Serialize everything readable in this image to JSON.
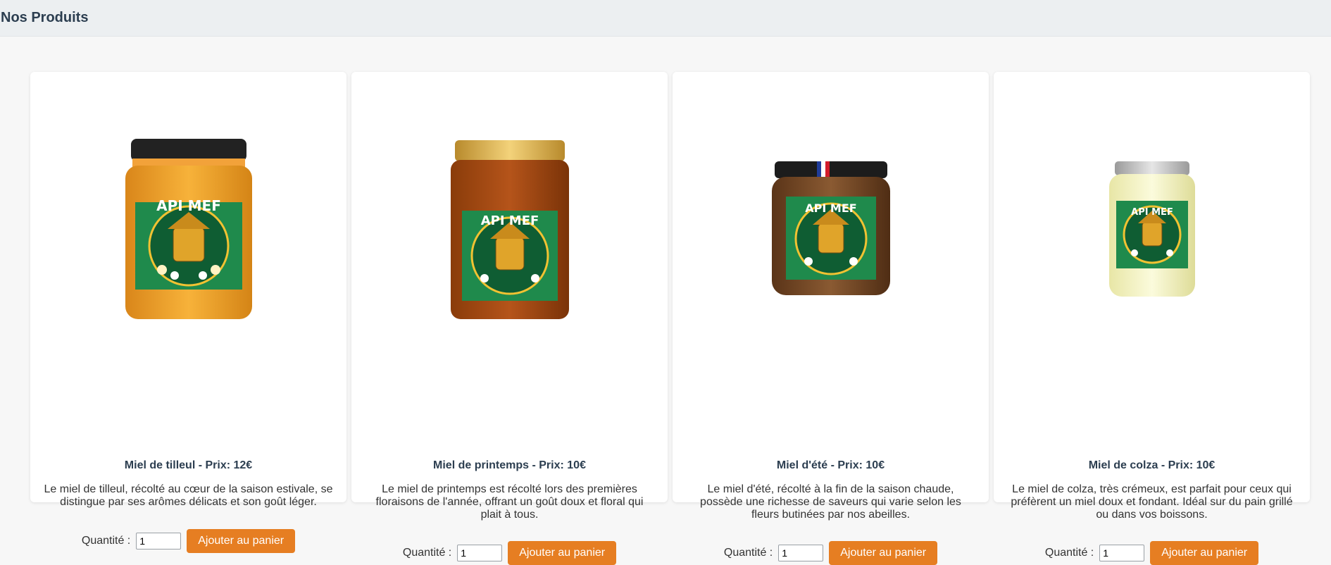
{
  "header": {
    "title": "Nos Produits"
  },
  "products": [
    {
      "title": "Miel de tilleul - Prix: 12€",
      "description": "Le miel de tilleul, récolté au cœur de la saison estivale, se distingue par ses arômes délicats et son goût léger.",
      "quantity_label": "Quantité :",
      "quantity_value": "1",
      "button_label": "Ajouter au panier",
      "label_text": "API MEF"
    },
    {
      "title": "Miel de printemps - Prix: 10€",
      "description": "Le miel de printemps est récolté lors des premières floraisons de l'année, offrant un goût doux et floral qui plait à tous.",
      "quantity_label": "Quantité :",
      "quantity_value": "1",
      "button_label": "Ajouter au panier",
      "label_text": "API MEF"
    },
    {
      "title": "Miel d'été - Prix: 10€",
      "description": "Le miel d'été, récolté à la fin de la saison chaude, possède une richesse de saveurs qui varie selon les fleurs butinées par nos abeilles.",
      "quantity_label": "Quantité :",
      "quantity_value": "1",
      "button_label": "Ajouter au panier",
      "label_text": "API MEF"
    },
    {
      "title": "Miel de colza - Prix: 10€",
      "description": "Le miel de colza, très crémeux, est parfait pour ceux qui préfèrent un miel doux et fondant. Idéal sur du pain grillé ou dans vos boissons.",
      "quantity_label": "Quantité :",
      "quantity_value": "1",
      "button_label": "Ajouter au panier",
      "label_text": "API MEF"
    }
  ],
  "colors": {
    "accent": "#e67e22",
    "label_green": "#1f8a4c",
    "title": "#2c3e50"
  }
}
